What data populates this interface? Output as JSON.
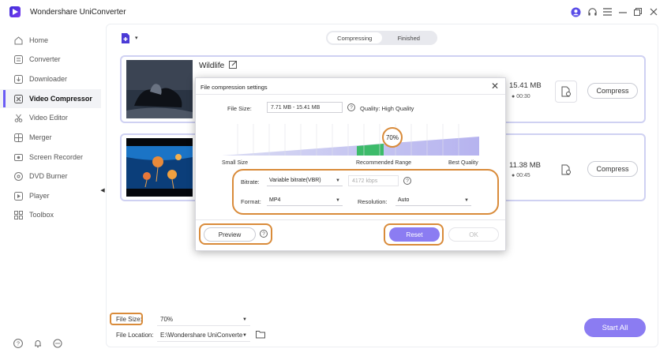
{
  "app": {
    "title": "Wondershare UniConverter"
  },
  "window_controls": {
    "icons": [
      "account-icon",
      "headset-icon",
      "menu-icon",
      "minimize-icon",
      "maximize-icon",
      "close-icon"
    ]
  },
  "sidebar": {
    "items": [
      {
        "label": "Home",
        "icon": "home-icon",
        "active": false
      },
      {
        "label": "Converter",
        "icon": "converter-icon",
        "active": false
      },
      {
        "label": "Downloader",
        "icon": "downloader-icon",
        "active": false
      },
      {
        "label": "Video Compressor",
        "icon": "compress-icon",
        "active": true
      },
      {
        "label": "Video Editor",
        "icon": "scissors-icon",
        "active": false
      },
      {
        "label": "Merger",
        "icon": "merger-icon",
        "active": false
      },
      {
        "label": "Screen Recorder",
        "icon": "recorder-icon",
        "active": false
      },
      {
        "label": "DVD Burner",
        "icon": "disc-icon",
        "active": false
      },
      {
        "label": "Player",
        "icon": "play-icon",
        "active": false
      },
      {
        "label": "Toolbox",
        "icon": "grid-icon",
        "active": false
      }
    ]
  },
  "tabs": {
    "compressing": "Compressing",
    "finished": "Finished",
    "active": "compressing"
  },
  "files": [
    {
      "name": "Wildlife",
      "size": "15.41 MB",
      "duration": "00:30",
      "action": "Compress"
    },
    {
      "name": "",
      "size": "11.38 MB",
      "duration": "00:45",
      "action": "Compress"
    }
  ],
  "dialog": {
    "title": "File compression settings",
    "file_size_label": "File Size:",
    "file_size_value": "7.71 MB - 15.41 MB",
    "quality_text": "Quality: High Quality",
    "percent": "70%",
    "level": 0.7,
    "scale_labels": {
      "left": "Small Size",
      "middle": "Recommended Range",
      "right": "Best Quality"
    },
    "bitrate_label": "Bitrate:",
    "bitrate_value": "Variable bitrate(VBR)",
    "bitrate_kbps": "4172 kbps",
    "format_label": "Format:",
    "format_value": "MP4",
    "resolution_label": "Resolution:",
    "resolution_value": "Auto",
    "preview": "Preview",
    "reset": "Reset",
    "ok": "OK"
  },
  "bottom": {
    "file_size_label": "File Size:",
    "file_size_value": "70%",
    "file_location_label": "File Location:",
    "file_location_value": "E:\\Wondershare UniConverte",
    "start_all": "Start All"
  },
  "colors": {
    "accent": "#8b7cf2",
    "highlight": "#d98b3a",
    "recommended": "#3dbb6a"
  }
}
